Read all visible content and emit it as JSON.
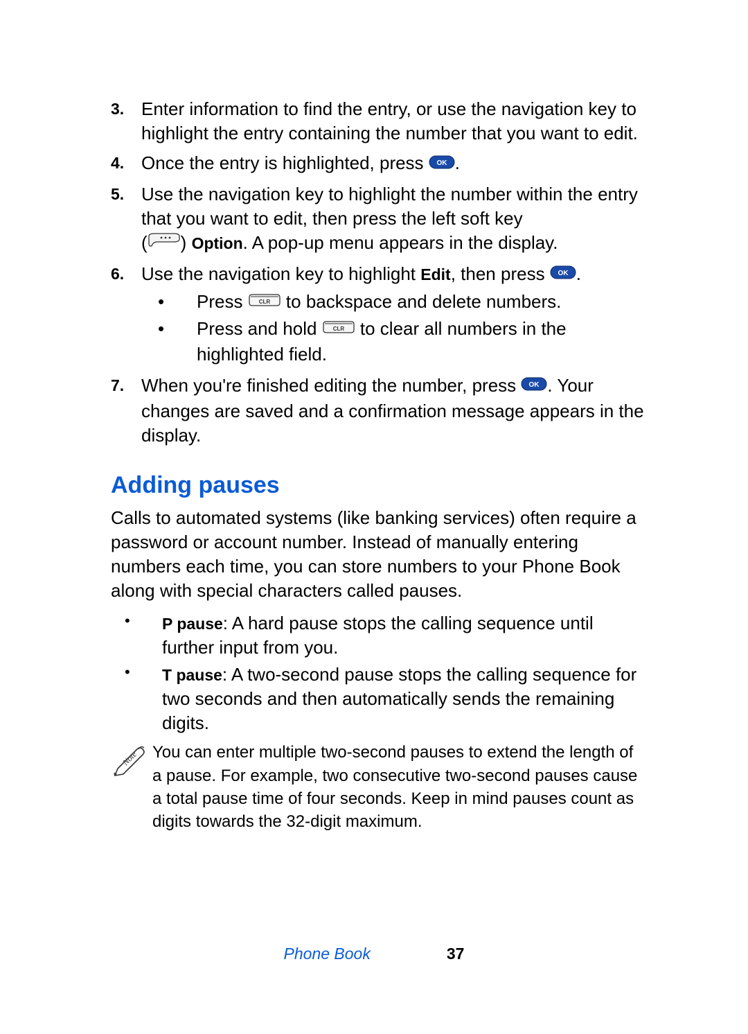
{
  "steps": {
    "s3": {
      "num": "3.",
      "text": "Enter information to find the entry, or use the navigation key to highlight the entry containing the number that you want to edit."
    },
    "s4": {
      "num": "4.",
      "text_before": "Once the entry is highlighted, press ",
      "text_after": "."
    },
    "s5": {
      "num": "5.",
      "line1": "Use the navigation key to highlight the number within the entry that you want to edit, then press the left soft key",
      "line2_open": "(",
      "line2_close": ") ",
      "option_label": "Option",
      "line2_after": ". A pop-up menu appears in the display."
    },
    "s6": {
      "num": "6.",
      "text_before": "Use the navigation key to highlight ",
      "edit_label": "Edit",
      "text_mid": ", then press ",
      "text_after": ".",
      "sub1_before": "Press ",
      "sub1_after": " to backspace and delete numbers.",
      "sub2_before": "Press and hold ",
      "sub2_after": " to clear all numbers in the highlighted field."
    },
    "s7": {
      "num": "7.",
      "text_before": "When you're finished editing the number, press ",
      "text_after": ". Your changes are saved and a confirmation message appears in the display."
    }
  },
  "heading": "Adding pauses",
  "intro": "Calls to automated systems (like banking services) often require a password or account number. Instead of manually entering numbers each time, you can store numbers to your Phone Book along with special characters called pauses.",
  "bullets": {
    "b1_label": "P pause",
    "b1_text": ": A hard pause stops the calling sequence until further input from you.",
    "b2_label": "T pause",
    "b2_text": ": A two-second pause stops the calling sequence for two seconds and then automatically sends the remaining digits."
  },
  "note": "You can enter multiple two-second pauses to extend the length of a pause. For example, two consecutive two-second pauses cause a total pause time of four seconds. Keep in mind pauses count as digits towards the 32-digit maximum.",
  "footer": {
    "chapter": "Phone Book",
    "page": "37"
  },
  "icons": {
    "ok": "ok-icon",
    "clr": "clr-icon",
    "softkey": "softkey-icon",
    "note": "note-icon"
  }
}
